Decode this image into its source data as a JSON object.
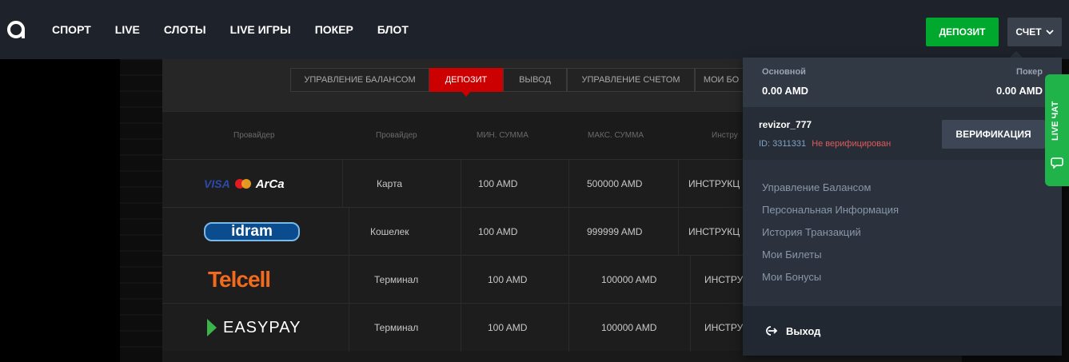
{
  "header": {
    "nav": [
      "СПОРТ",
      "LIVE",
      "СЛОТЫ",
      "LIVE ИГРЫ",
      "ПОКЕР",
      "БЛОТ"
    ],
    "deposit_button": "ДЕПОЗИТ",
    "account_button": "СЧЕТ"
  },
  "tabs": {
    "items": [
      "УПРАВЛЕНИЕ БАЛАНСОМ",
      "ДЕПОЗИТ",
      "ВЫВОД",
      "УПРАВЛЕНИЕ СЧЕТОМ",
      "МОИ БО"
    ],
    "active": "ДЕПОЗИТ"
  },
  "table": {
    "headers": [
      "Провайдер",
      "Провайдер",
      "МИН. СУММА",
      "МАКС. СУММА",
      "Инстру"
    ],
    "rows": [
      {
        "logo": "visa-mastercard-arca-logo",
        "logo_text": [
          "VISA",
          "ArCa"
        ],
        "type": "Карта",
        "min": "100 AMD",
        "max": "500000 AMD",
        "instr": "ИНСТРУКЦ"
      },
      {
        "logo": "idram-logo",
        "logo_text": [
          "idram"
        ],
        "type": "Кошелек",
        "min": "100 AMD",
        "max": "999999 AMD",
        "instr": "ИНСТРУКЦ"
      },
      {
        "logo": "telcell-logo",
        "logo_text": [
          "Telcell"
        ],
        "type": "Терминал",
        "min": "100 AMD",
        "max": "100000 AMD",
        "instr": "ИНСТРУ"
      },
      {
        "logo": "easypay-logo",
        "logo_text": [
          "EASY",
          "PAY"
        ],
        "type": "Терминал",
        "min": "100 AMD",
        "max": "100000 AMD",
        "instr": "ИНСТРУ"
      }
    ]
  },
  "account_dropdown": {
    "main_label": "Основной",
    "main_value": "0.00 AMD",
    "poker_label": "Покер",
    "poker_value": "0.00 AMD",
    "username": "revizor_777",
    "user_id": "ID: 3311331",
    "status": "Не верифицирован",
    "verify_button": "ВЕРИФИКАЦИЯ",
    "menu": [
      "Управление Балансом",
      "Персональная Информация",
      "История Транзакций",
      "Мои Билеты",
      "Мои Бонусы"
    ],
    "logout": "Выход"
  },
  "live_chat": "LIVE ЧАТ",
  "colors": {
    "header_bg": "#1e232b",
    "deposit_green": "#00a82d",
    "active_tab_red": "#cc0000",
    "dropdown_bg": "#2b323d",
    "unverified_red": "#e05a5a",
    "live_chat_green": "#1fb34a"
  }
}
